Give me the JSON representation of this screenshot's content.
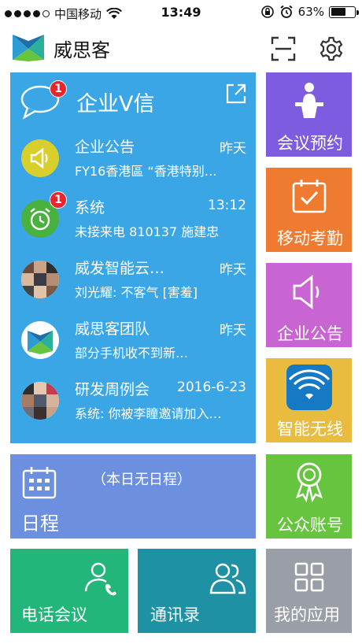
{
  "status_bar": {
    "carrier": "中国移动",
    "time": "13:49",
    "battery": "63%",
    "battery_level": 0.63
  },
  "header": {
    "app_name": "威思客",
    "logo_icon": "weisike-logo-icon",
    "scan_icon": "scan-icon",
    "settings_icon": "gear-icon"
  },
  "messages_panel": {
    "title": "企业V信",
    "badge": "1",
    "color": "#3aa6e6",
    "items": [
      {
        "name": "企业公告",
        "time": "昨天",
        "preview": "FY16香港區 “香港特别…",
        "icon": "speaker-icon",
        "badge": ""
      },
      {
        "name": "系统",
        "time": "13:12",
        "preview": "未接来电 810137 施建忠",
        "icon": "alarm-clock-icon",
        "badge": "1"
      },
      {
        "name": "威发智能云…",
        "time": "昨天",
        "preview": "刘光耀: 不客气 [害羞]",
        "icon": "group-avatar",
        "badge": ""
      },
      {
        "name": "威思客团队",
        "time": "昨天",
        "preview": "部分手机收不到新…",
        "icon": "weisike-logo-icon",
        "badge": ""
      },
      {
        "name": "研发周例会",
        "time": "2016-6-23",
        "preview": "系统: 你被李瞳邀请加入…",
        "icon": "group-avatar",
        "badge": ""
      }
    ]
  },
  "schedule": {
    "label": "日程",
    "note": "（本日无日程）",
    "icon": "calendar-icon",
    "color": "#6c8fdf"
  },
  "right_tiles": [
    {
      "label": "会议预约",
      "icon": "podium-icon",
      "color": "#7d5ce0"
    },
    {
      "label": "移动考勤",
      "icon": "calendar-check-icon",
      "color": "#ef7b31"
    },
    {
      "label": "企业公告",
      "icon": "speaker-icon",
      "color": "#c865d3"
    },
    {
      "label": "智能无线",
      "icon": "wifi-icon",
      "color": "#e9bb3e"
    },
    {
      "label": "公众账号",
      "icon": "award-ribbon-icon",
      "color": "#66c43f"
    },
    {
      "label": "我的应用",
      "icon": "apps-grid-icon",
      "color": "#9a9ea6"
    }
  ],
  "bottom_tiles": [
    {
      "label": "电话会议",
      "icon": "person-phone-icon",
      "color": "#23b67a"
    },
    {
      "label": "通讯录",
      "icon": "contacts-icon",
      "color": "#1e91a4"
    }
  ]
}
